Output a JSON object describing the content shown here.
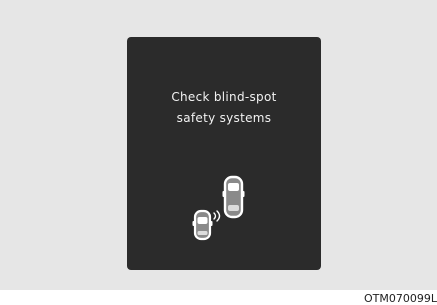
{
  "display": {
    "message_line1": "Check blind-spot",
    "message_line2": "safety systems"
  },
  "icon": "blind-spot-cars-icon",
  "figure_code": "OTM070099L",
  "colors": {
    "figure_background": "#e6e6e6",
    "panel": "#2b2b2b",
    "message_text": "#f2f2f2",
    "car_outline": "#ffffff",
    "car_fill": "#8a8a8a"
  }
}
